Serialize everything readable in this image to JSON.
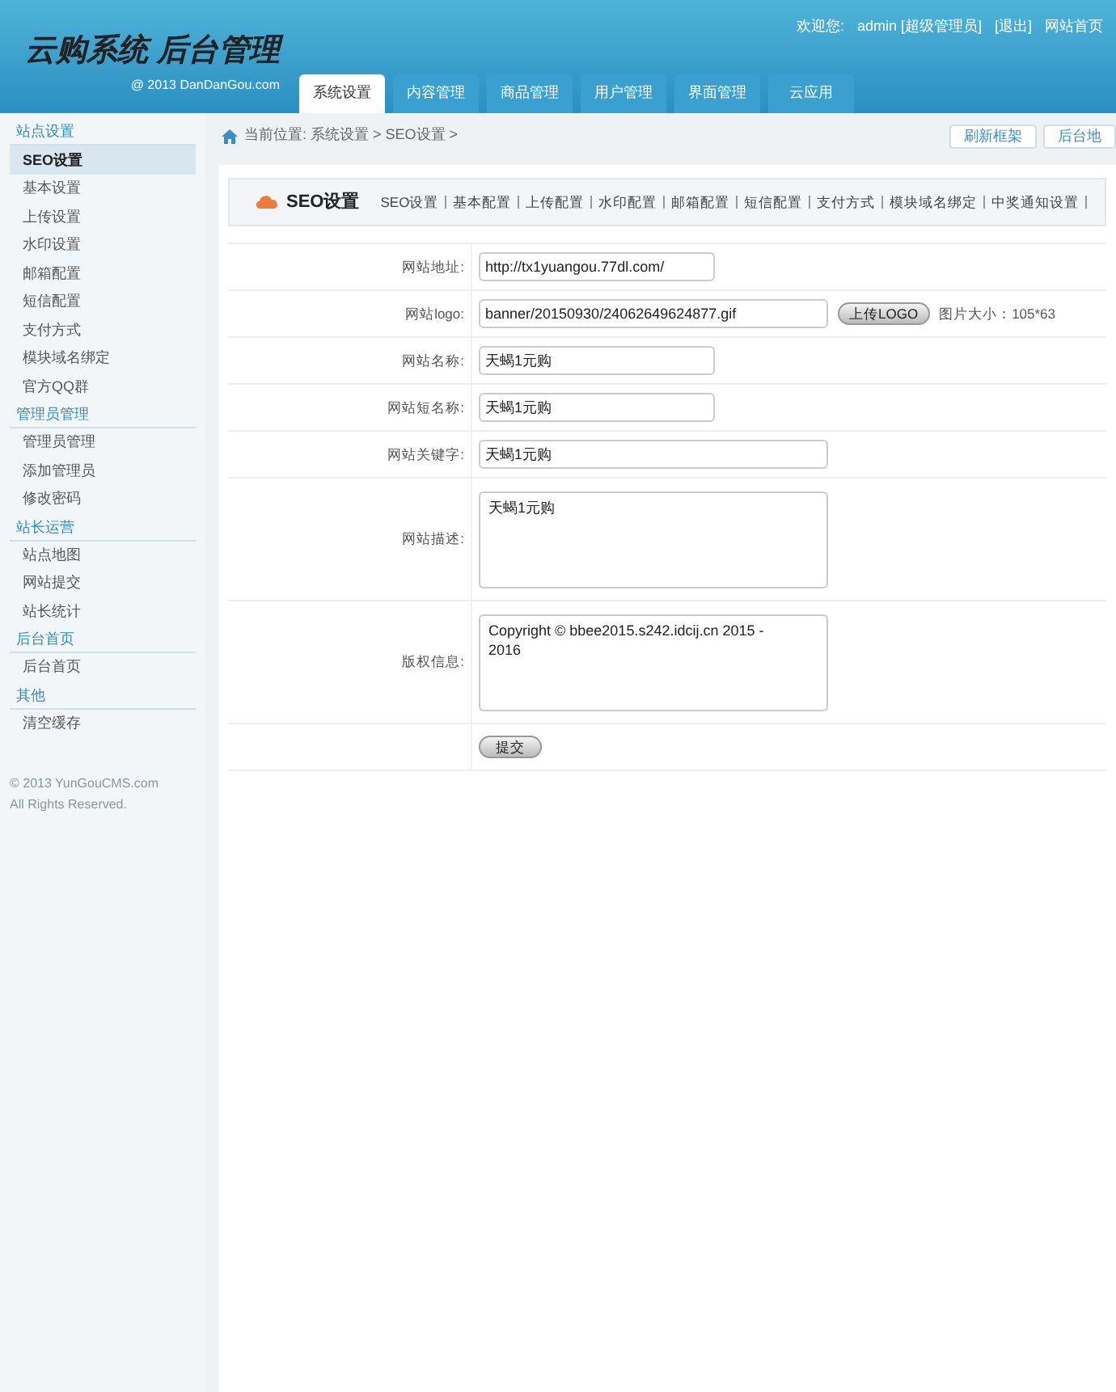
{
  "header": {
    "logo_title": "云购系统 后台管理",
    "logo_sub": "@ 2013  DanDanGou.com",
    "welcome": "欢迎您:",
    "user": "admin [超级管理员]",
    "logout": "[退出]",
    "home": "网站首页"
  },
  "tabs": [
    {
      "label": "系统设置",
      "selected": true
    },
    {
      "label": "内容管理",
      "selected": false
    },
    {
      "label": "商品管理",
      "selected": false
    },
    {
      "label": "用户管理",
      "selected": false
    },
    {
      "label": "界面管理",
      "selected": false
    },
    {
      "label": "云应用",
      "selected": false
    }
  ],
  "sidebar": {
    "groups": [
      {
        "title": "站点设置",
        "items": [
          {
            "label": "SEO设置",
            "selected": true
          },
          {
            "label": "基本设置",
            "selected": false
          },
          {
            "label": "上传设置",
            "selected": false
          },
          {
            "label": "水印设置",
            "selected": false
          },
          {
            "label": "邮箱配置",
            "selected": false
          },
          {
            "label": "短信配置",
            "selected": false
          },
          {
            "label": "支付方式",
            "selected": false
          },
          {
            "label": "模块域名绑定",
            "selected": false
          },
          {
            "label": "官方QQ群",
            "selected": false
          }
        ]
      },
      {
        "title": "管理员管理",
        "items": [
          {
            "label": "管理员管理",
            "selected": false
          },
          {
            "label": "添加管理员",
            "selected": false
          },
          {
            "label": "修改密码",
            "selected": false
          }
        ]
      },
      {
        "title": "站长运营",
        "items": [
          {
            "label": "站点地图",
            "selected": false
          },
          {
            "label": "网站提交",
            "selected": false
          },
          {
            "label": "站长统计",
            "selected": false
          }
        ]
      },
      {
        "title": "后台首页",
        "items": [
          {
            "label": "后台首页",
            "selected": false
          }
        ]
      },
      {
        "title": "其他",
        "items": [
          {
            "label": "清空缓存",
            "selected": false
          }
        ]
      }
    ],
    "footer": [
      "© 2013 YunGouCMS.com",
      "All Rights Reserved."
    ]
  },
  "breadcrumb": "当前位置: 系统设置 > SEO设置 >",
  "top_buttons": [
    "刷新框架",
    "后台地"
  ],
  "panel": {
    "title": "SEO设置",
    "links": [
      "SEO设置",
      "基本配置",
      "上传配置",
      "水印配置",
      "邮箱配置",
      "短信配置",
      "支付方式",
      "模块域名绑定",
      "中奖通知设置"
    ]
  },
  "form": {
    "rows": [
      {
        "kind": "input",
        "label": "网站地址:",
        "value": "http://tx1yuangou.77dl.com/"
      },
      {
        "kind": "file",
        "label": "网站logo:",
        "value": "banner/20150930/24062649624877.gif",
        "button": "上传LOGO",
        "note": "图片大小：105*63"
      },
      {
        "kind": "input",
        "label": "网站名称:",
        "value": "天蝎1元购"
      },
      {
        "kind": "input",
        "label": "网站短名称:",
        "value": "天蝎1元购"
      },
      {
        "kind": "input_long",
        "label": "网站关键字:",
        "value": "天蝎1元购"
      },
      {
        "kind": "textarea",
        "label": "网站描述:",
        "value": "天蝎1元购"
      },
      {
        "kind": "textarea",
        "label": "版权信息:",
        "value": "Copyright © bbee2015.s242.idcij.cn 2015 - 2016"
      }
    ],
    "submit": "提交"
  }
}
